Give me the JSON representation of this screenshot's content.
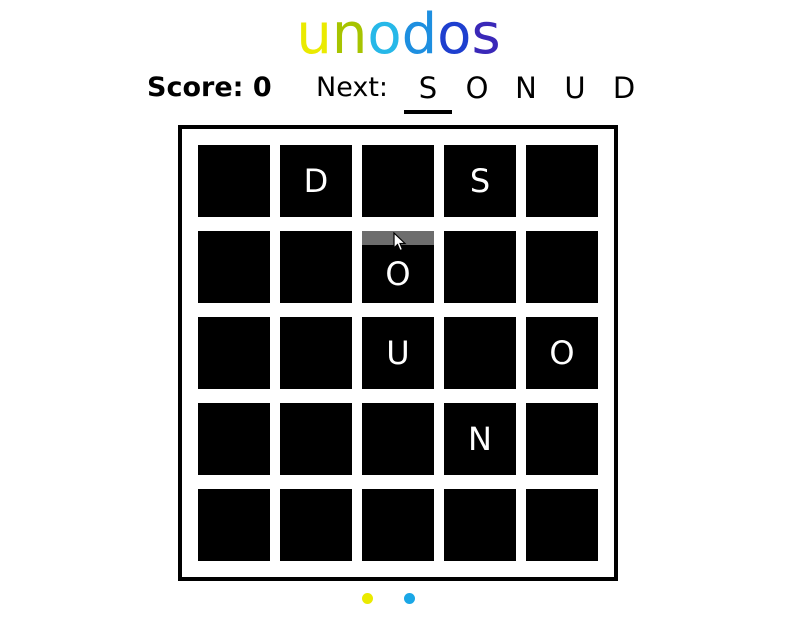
{
  "title": {
    "letters": [
      "u",
      "n",
      "o",
      "d",
      "o",
      "s"
    ],
    "colors": [
      "#eaea00",
      "#a7c400",
      "#27b8e8",
      "#1e8fe0",
      "#1e3fcf",
      "#3a28b8"
    ]
  },
  "score_label": "Score: 0",
  "next_label": "Next:",
  "next_queue": [
    "S",
    "O",
    "N",
    "U",
    "D"
  ],
  "board": {
    "rows": [
      [
        "",
        "D",
        "",
        "S",
        ""
      ],
      [
        "",
        "",
        "O",
        "",
        ""
      ],
      [
        "",
        "",
        "U",
        "",
        "O"
      ],
      [
        "",
        "",
        "",
        "N",
        ""
      ],
      [
        "",
        "",
        "",
        "",
        ""
      ]
    ],
    "hover_cell": {
      "row": 1,
      "col": 2
    }
  },
  "dots": [
    {
      "color": "#eaea00"
    },
    {
      "color": "#1aa7e6"
    }
  ],
  "icons": {
    "cursor": "arrow-cursor-icon"
  }
}
